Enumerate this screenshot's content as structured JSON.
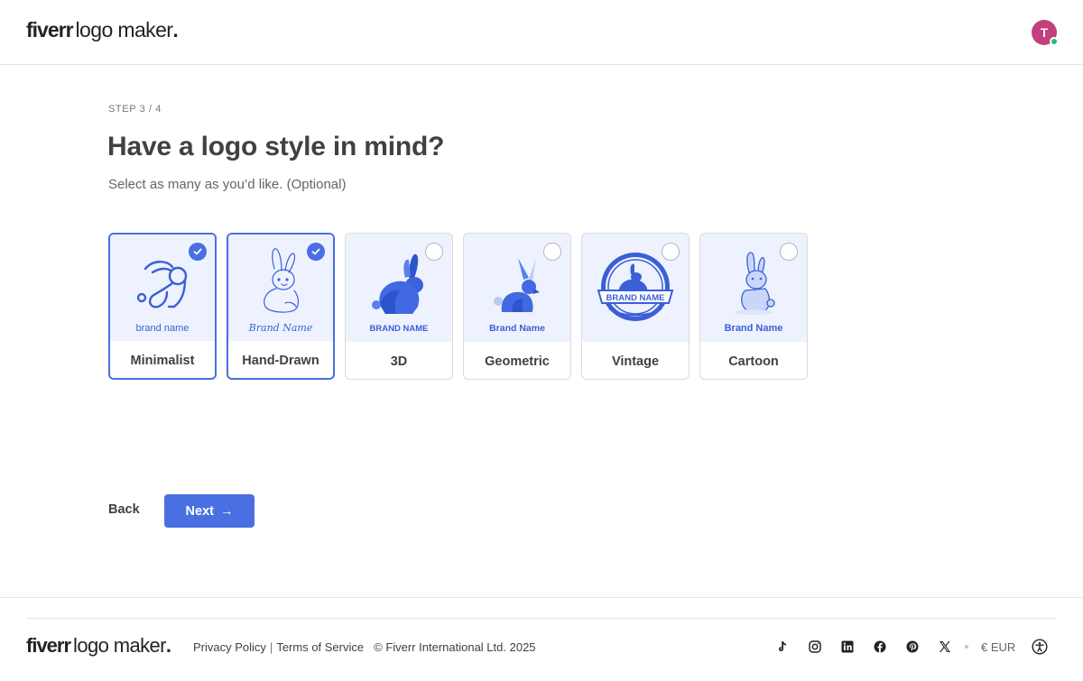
{
  "header": {
    "logo_brand": "fiverr",
    "logo_product": "logo maker",
    "logo_dot": ".",
    "avatar_initial": "T"
  },
  "main": {
    "step": "STEP 3 / 4",
    "title": "Have a logo style in mind?",
    "subtitle": "Select as many as you’d like. (Optional)",
    "styles": [
      {
        "label": "Minimalist",
        "sample_text": "brand name",
        "selected": true
      },
      {
        "label": "Hand-Drawn",
        "sample_text": "Brand Name",
        "selected": true
      },
      {
        "label": "3D",
        "sample_text": "BRAND NAME",
        "selected": false
      },
      {
        "label": "Geometric",
        "sample_text": "Brand Name",
        "selected": false
      },
      {
        "label": "Vintage",
        "sample_text": "BRAND NAME",
        "selected": false
      },
      {
        "label": "Cartoon",
        "sample_text": "Brand Name",
        "selected": false
      }
    ],
    "back_label": "Back",
    "next_label": "Next",
    "next_arrow": "→"
  },
  "footer": {
    "logo_brand": "fiverr",
    "logo_product": "logo maker",
    "logo_dot": ".",
    "privacy": "Privacy Policy",
    "separator": "|",
    "terms": "Terms of Service",
    "copyright": "© Fiverr International Ltd. 2025",
    "socials": [
      "tiktok-icon",
      "instagram-icon",
      "linkedin-icon",
      "facebook-icon",
      "pinterest-icon",
      "x-icon"
    ],
    "currency": "€ EUR"
  },
  "colors": {
    "accent": "#4a6fe3",
    "thumb_bg": "#edf2fe",
    "avatar_bg": "#c43f7e",
    "online": "#1dbf73",
    "text": "#404145"
  }
}
